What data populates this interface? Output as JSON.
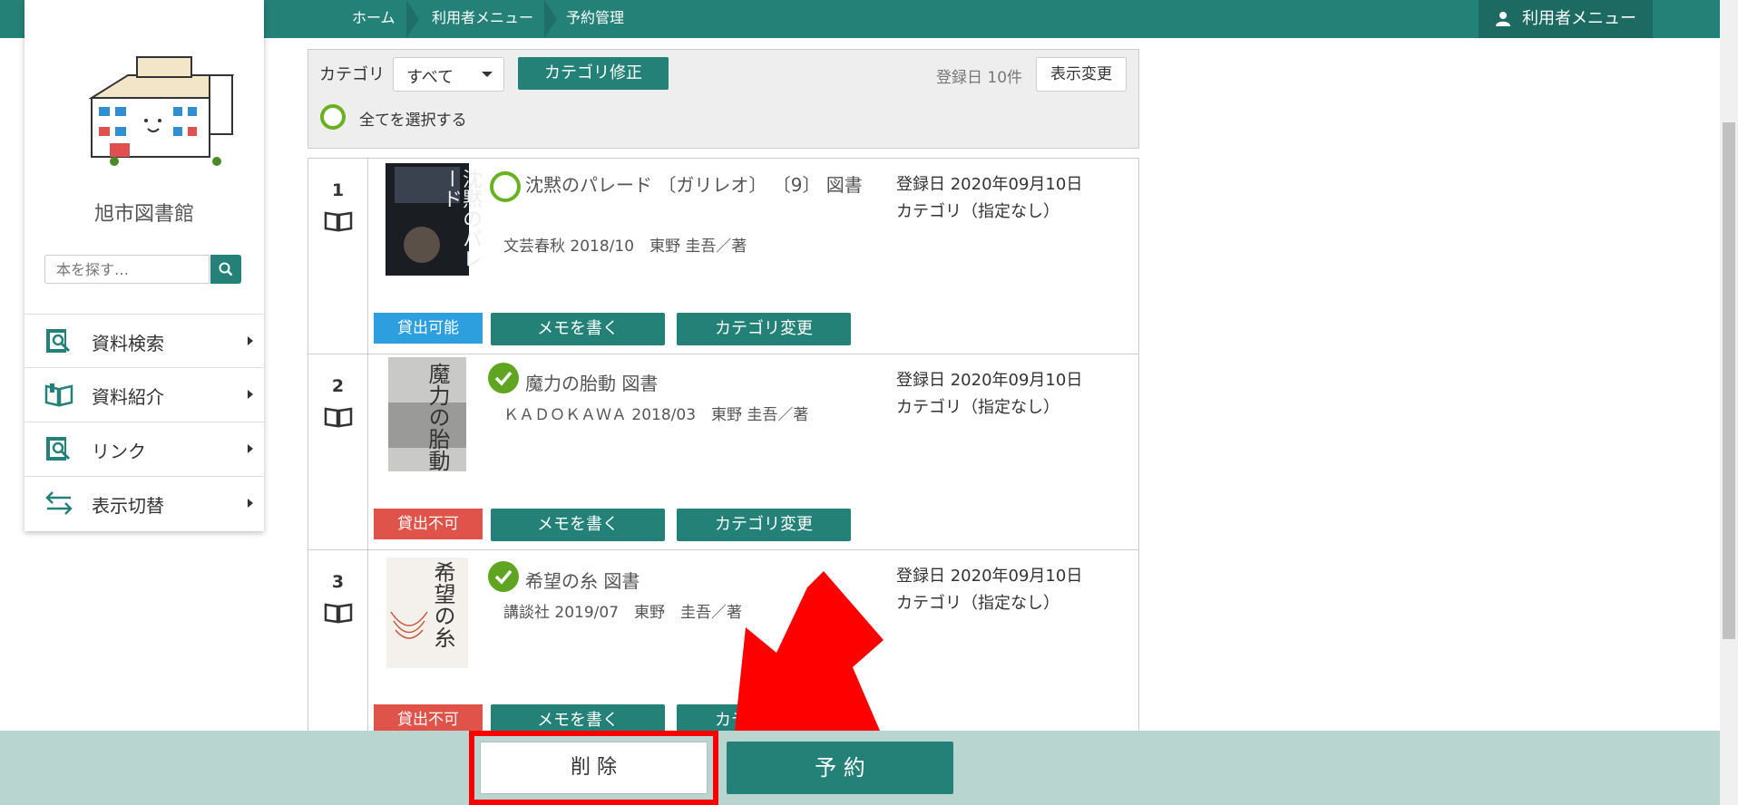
{
  "breadcrumb": {
    "home": "ホーム",
    "user_menu": "利用者メニュー",
    "current": "予約管理"
  },
  "header": {
    "user_menu_label": "利用者メニュー"
  },
  "library": {
    "name": "旭市図書館"
  },
  "search": {
    "placeholder": "本を探す…"
  },
  "sidebar": {
    "items": [
      {
        "label": "資料検索",
        "icon": "search-book-icon"
      },
      {
        "label": "資料紹介",
        "icon": "open-book-icon"
      },
      {
        "label": "リンク",
        "icon": "search-book-icon"
      },
      {
        "label": "表示切替",
        "icon": "switch-arrows-icon"
      }
    ]
  },
  "filter": {
    "category_label": "カテゴリ",
    "category_value": "すべて",
    "category_edit_button": "カテゴリ修正",
    "sort_info": "登録日 10件",
    "display_change_button": "表示変更",
    "select_all_label": "全てを選択する"
  },
  "items": [
    {
      "num": "1",
      "title": "沈黙のパレード 〔ガリレオ〕 〔9〕 図書",
      "meta": "文芸春秋 2018/10　東野 圭吾／著",
      "registered": "登録日 2020年09月10日",
      "category": "カテゴリ（指定なし）",
      "status": "貸出可能",
      "memo_button": "メモを書く",
      "category_button": "カテゴリ変更",
      "selected": false
    },
    {
      "num": "2",
      "title": "魔力の胎動 図書",
      "meta": "ＫＡＤＯＫＡＷＡ 2018/03　東野 圭吾／著",
      "registered": "登録日 2020年09月10日",
      "category": "カテゴリ（指定なし）",
      "status": "貸出不可",
      "memo_button": "メモを書く",
      "category_button": "カテゴリ変更",
      "selected": true
    },
    {
      "num": "3",
      "title": "希望の糸 図書",
      "meta": "講談社 2019/07　東野　圭吾／著",
      "registered": "登録日 2020年09月10日",
      "category": "カテゴリ（指定なし）",
      "status": "貸出不可",
      "memo_button": "メモを書く",
      "category_button": "カテゴリ変更",
      "selected": true
    }
  ],
  "book_covers": [
    "沈黙のパレード",
    "魔力の胎動",
    "希望の糸"
  ],
  "actions": {
    "delete_button": "削 除",
    "reserve_button": "予 約"
  },
  "colors": {
    "teal": "#248178",
    "available": "#2e9fde",
    "unavailable": "#e0534a",
    "check_green": "#5fa521",
    "highlight_red": "#ff0000",
    "bottom_bar": "#b9d5d0"
  }
}
